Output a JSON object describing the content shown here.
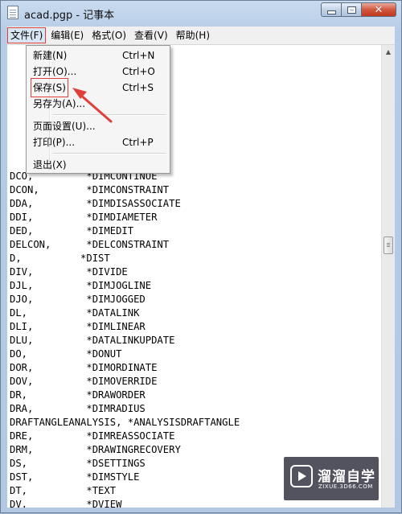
{
  "window": {
    "title": "acad.pgp - 记事本"
  },
  "menubar": {
    "items": [
      "文件(F)",
      "编辑(E)",
      "格式(O)",
      "查看(V)",
      "帮助(H)"
    ]
  },
  "file_menu": {
    "items": [
      {
        "label": "新建(N)",
        "shortcut": "Ctrl+N"
      },
      {
        "label": "打开(O)...",
        "shortcut": "Ctrl+O"
      },
      {
        "label": "保存(S)",
        "shortcut": "Ctrl+S"
      },
      {
        "label": "另存为(A)...",
        "shortcut": ""
      },
      {
        "label": "页面设置(U)...",
        "shortcut": ""
      },
      {
        "label": "打印(P)...",
        "shortcut": "Ctrl+P"
      },
      {
        "label": "退出(X)",
        "shortcut": ""
      }
    ]
  },
  "document": {
    "lines": [
      "DCO,         *DIMCONTINUE",
      "DCON,        *DIMCONSTRAINT",
      "DDA,         *DIMDISASSOCIATE",
      "DDI,         *DIMDIAMETER",
      "DED,         *DIMEDIT",
      "DELCON,      *DELCONSTRAINT",
      "D,          *DIST",
      "DIV,         *DIVIDE",
      "DJL,         *DIMJOGLINE",
      "DJO,         *DIMJOGGED",
      "DL,          *DATALINK",
      "DLI,         *DIMLINEAR",
      "DLU,         *DATALINKUPDATE",
      "DO,          *DONUT",
      "DOR,         *DIMORDINATE",
      "DOV,         *DIMOVERRIDE",
      "DR,          *DRAWORDER",
      "DRA,         *DIMRADIUS",
      "DRAFTANGLEANALYSIS, *ANALYSISDRAFTANGLE",
      "DRE,         *DIMREASSOCIATE",
      "DRM,         *DRAWINGRECOVERY",
      "DS,          *DSETTINGS",
      "DST,         *DIMSTYLE",
      "DT,          *TEXT",
      "DV,          *DVIEW"
    ]
  },
  "watermark": {
    "title": "溜溜自学",
    "url": "ZIXUE.3D66.COM"
  },
  "colors": {
    "annotation": "#e0403a",
    "frame": "#b6cce6"
  }
}
